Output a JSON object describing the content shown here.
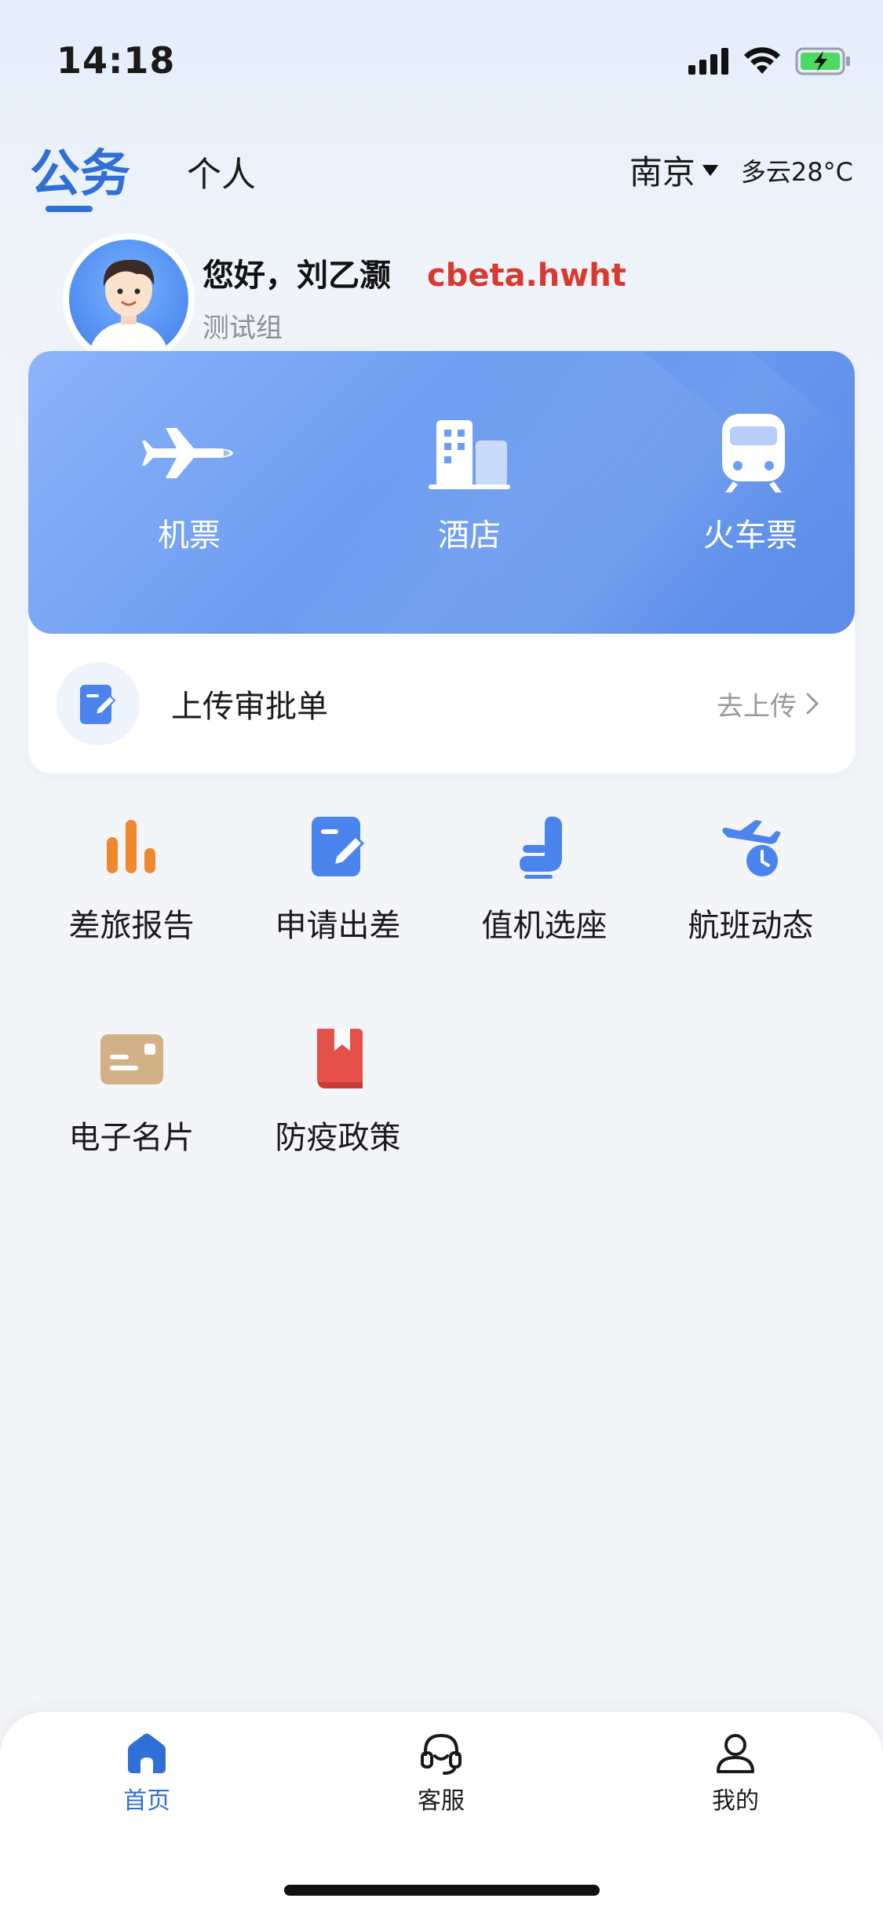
{
  "status_bar": {
    "time": "14:18",
    "icons": [
      "signal-icon",
      "wifi-icon",
      "battery-charging-icon"
    ]
  },
  "header": {
    "tabs": [
      {
        "label": "公务",
        "active": true
      },
      {
        "label": "个人",
        "active": false
      }
    ],
    "city": "南京",
    "weather": "多云28°C"
  },
  "greeting": {
    "text": "您好，刘乙灏",
    "domain": "cbeta.hwht",
    "group": "测试组"
  },
  "services": [
    {
      "label": "机票",
      "icon": "airplane-icon"
    },
    {
      "label": "酒店",
      "icon": "hotel-icon"
    },
    {
      "label": "火车票",
      "icon": "train-icon"
    }
  ],
  "upload": {
    "label": "上传审批单",
    "action": "去上传",
    "icon": "edit-document-icon"
  },
  "grid_items": [
    {
      "label": "差旅报告",
      "icon": "bar-chart-icon",
      "color": "#f0892e"
    },
    {
      "label": "申请出差",
      "icon": "edit-document-icon",
      "color": "#4a84ec"
    },
    {
      "label": "值机选座",
      "icon": "seat-icon",
      "color": "#4a84ec"
    },
    {
      "label": "航班动态",
      "icon": "flight-clock-icon",
      "color": "#4a84ec"
    },
    {
      "label": "电子名片",
      "icon": "business-card-icon",
      "color": "#d2b187"
    },
    {
      "label": "防疫政策",
      "icon": "book-bookmark-icon",
      "color": "#e5504a"
    }
  ],
  "tabbar": [
    {
      "label": "首页",
      "icon": "home-icon",
      "active": true
    },
    {
      "label": "客服",
      "icon": "headset-icon",
      "active": false
    },
    {
      "label": "我的",
      "icon": "user-icon",
      "active": false
    }
  ],
  "colors": {
    "accent": "#2f6fd6",
    "domain_red": "#d93a2f",
    "card_blue": "#6d9cf0"
  }
}
